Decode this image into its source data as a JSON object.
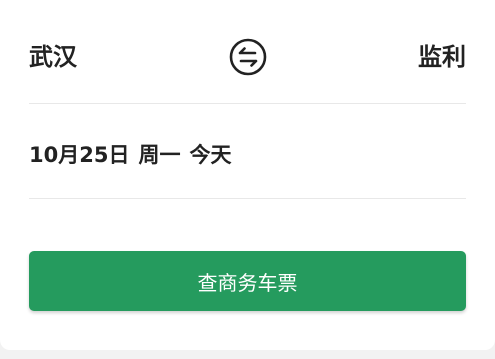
{
  "route": {
    "from_city": "武汉",
    "to_city": "监利",
    "swap_icon": "swap-arrows-icon"
  },
  "date": {
    "date_text": "10月25日",
    "weekday_text": "周一",
    "relative_text": "今天"
  },
  "actions": {
    "search_label": "查商务车票"
  },
  "colors": {
    "primary": "#259b5e",
    "text": "#222222",
    "divider": "#e8e8e8",
    "background": "#f2f2f2"
  }
}
